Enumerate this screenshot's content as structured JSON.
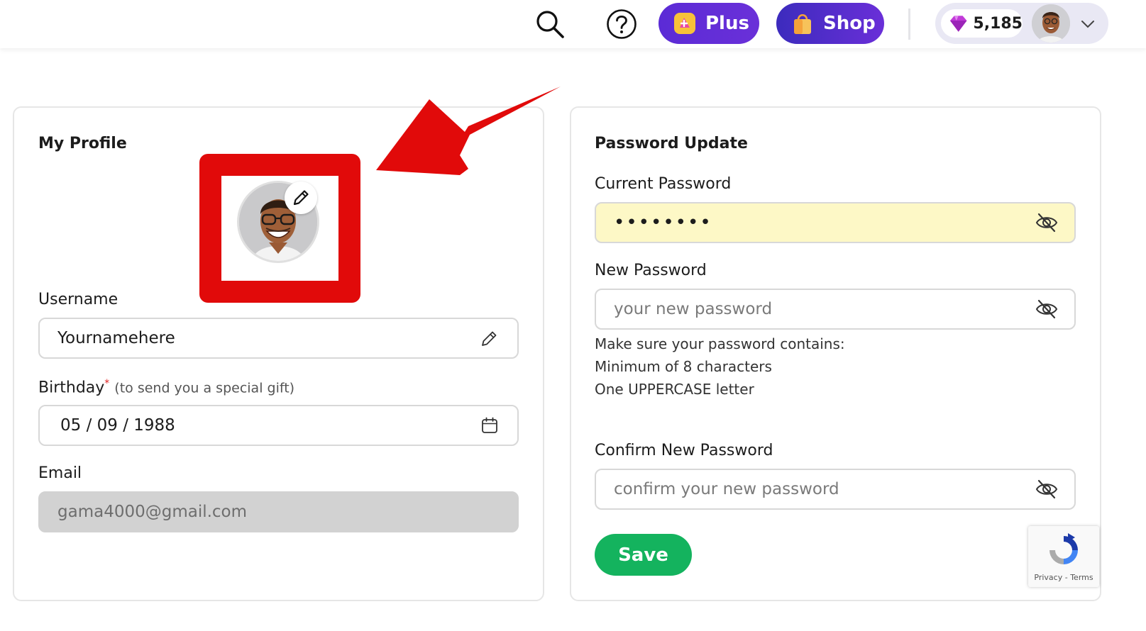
{
  "header": {
    "plus_label": "Plus",
    "shop_label": "Shop",
    "gems_count": "5,185"
  },
  "profile": {
    "title": "My Profile",
    "username_label": "Username",
    "username_value": "Yournamehere",
    "birthday_label": "Birthday",
    "birthday_required": "*",
    "birthday_note": "(to send you a special gift)",
    "birthday_value": "05 / 09 / 1988",
    "email_label": "Email",
    "email_value": "gama4000@gmail.com"
  },
  "password": {
    "title": "Password Update",
    "current_label": "Current Password",
    "current_value": "••••••••",
    "new_label": "New Password",
    "new_placeholder": "your new password",
    "hint_intro": "Make sure your password contains:",
    "hint_min": "Minimum of 8 characters",
    "hint_upper": "One UPPERCASE letter",
    "confirm_label": "Confirm New Password",
    "confirm_placeholder": "confirm your new password",
    "save_label": "Save"
  },
  "recaptcha": {
    "links": "Privacy - Terms"
  },
  "colors": {
    "annotation_red": "#e10a0a",
    "save_green": "#14b35e",
    "plus_purple": "#5b2bd6"
  }
}
